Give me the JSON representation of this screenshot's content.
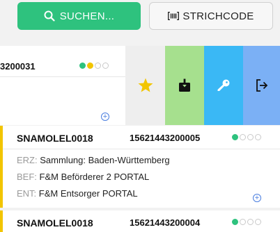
{
  "toolbar": {
    "search_label": "SUCHEN...",
    "barcode_label": "STRICHCODE"
  },
  "swiped_item": {
    "number_fragment": "3200031",
    "status": [
      "green",
      "yellow",
      "empty",
      "empty"
    ]
  },
  "actions": [
    {
      "icon": "star-icon",
      "color": "#f2c500"
    },
    {
      "icon": "download-icon",
      "color": "#111111"
    },
    {
      "icon": "key-icon",
      "color": "#ffffff"
    },
    {
      "icon": "logout-icon",
      "color": "#111111"
    }
  ],
  "cards": [
    {
      "code": "SNAMOLEL0018",
      "number": "15621443200005",
      "status": [
        "green",
        "empty",
        "empty",
        "empty"
      ],
      "erz_label": "ERZ:",
      "erz_value": "Sammlung: Baden-Württemberg",
      "bef_label": "BEF:",
      "bef_value": "F&M Beförderer 2 PORTAL",
      "ent_label": "ENT:",
      "ent_value": "F&M Entsorger PORTAL"
    },
    {
      "code": "SNAMOLEL0018",
      "number": "15621443200004",
      "status": [
        "green",
        "empty",
        "empty",
        "empty"
      ]
    }
  ],
  "colors": {
    "accent_green": "#2ec27e",
    "accent_yellow": "#f2c500",
    "action_green": "#a6e08e",
    "action_blue": "#3ab8f5",
    "action_lightblue": "#7bb0f5"
  }
}
